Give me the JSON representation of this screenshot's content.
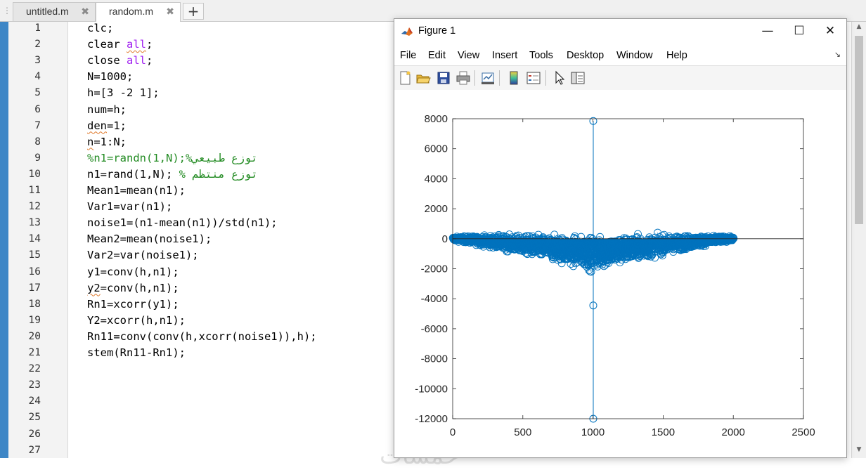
{
  "tabs": [
    {
      "label": "untitled.m",
      "close": "✖",
      "active": false
    },
    {
      "label": "random.m",
      "close": "✖",
      "active": true
    }
  ],
  "add_tab_label": "+",
  "editor": {
    "line_numbers": [
      "1",
      "2",
      "3",
      "4",
      "5",
      "6",
      "7",
      "8",
      "9",
      "10",
      "11",
      "12",
      "13",
      "14",
      "15",
      "16",
      "17",
      "18",
      "19",
      "20",
      "21",
      "22",
      "23",
      "24",
      "25",
      "26",
      "27"
    ],
    "lines": [
      [
        {
          "t": "clc;"
        }
      ],
      [
        {
          "t": "clear "
        },
        {
          "t": "all",
          "c": "kw sq"
        },
        {
          "t": ";"
        }
      ],
      [
        {
          "t": "close "
        },
        {
          "t": "all",
          "c": "kw"
        },
        {
          "t": ";"
        }
      ],
      [
        {
          "t": "N=1000;"
        }
      ],
      [
        {
          "t": "h=[3 -2 1];"
        }
      ],
      [
        {
          "t": "num=h;"
        }
      ],
      [
        {
          "t": "den",
          "c": "sq"
        },
        {
          "t": "=1;"
        }
      ],
      [
        {
          "t": "n",
          "c": "sq"
        },
        {
          "t": "=1:N;"
        }
      ],
      [
        {
          "t": "%n1=randn(1,N);%توزع طبيعي",
          "c": "cmt"
        }
      ],
      [
        {
          "t": "n1=rand(1,N); "
        },
        {
          "t": "% توزع منتظم",
          "c": "cmt"
        }
      ],
      [
        {
          "t": "Mean1=mean(n1);"
        }
      ],
      [
        {
          "t": "Var1=var(n1);"
        }
      ],
      [
        {
          "t": "noise1=(n1-mean(n1))/std(n1);"
        }
      ],
      [
        {
          "t": "Mean2=mean(noise1);"
        }
      ],
      [
        {
          "t": "Var2=var(noise1);"
        }
      ],
      [
        {
          "t": "y1=conv(h,n1);"
        }
      ],
      [
        {
          "t": "y2",
          "c": "sq"
        },
        {
          "t": "=conv(h,n1);"
        }
      ],
      [
        {
          "t": "Rn1=xcorr(y1);"
        }
      ],
      [
        {
          "t": "Y2=xcorr(h,n1);"
        }
      ],
      [
        {
          "t": "Rn11=conv(conv(h,xcorr(noise1)),h);"
        }
      ],
      [
        {
          "t": "stem(Rn11-Rn1);"
        }
      ]
    ],
    "watermark": "خمسات"
  },
  "figure": {
    "title": "Figure 1",
    "window_buttons": {
      "minimize": "—",
      "maximize": "☐",
      "close": "✕"
    },
    "menu": [
      "File",
      "Edit",
      "View",
      "Insert",
      "Tools",
      "Desktop",
      "Window",
      "Help"
    ],
    "menu_dock_icon": "↘",
    "toolbar_icons": [
      "new-figure-icon",
      "open-file-icon",
      "save-icon",
      "print-icon",
      "link-plot-icon",
      "colorbar-icon",
      "legend-icon",
      "pointer-icon",
      "property-inspector-icon"
    ]
  },
  "chart_data": {
    "type": "stem",
    "xlim": [
      0,
      2500
    ],
    "ylim": [
      -12000,
      8000
    ],
    "xticks": [
      0,
      500,
      1000,
      1500,
      2000,
      2500
    ],
    "yticks": [
      8000,
      6000,
      4000,
      2000,
      0,
      -2000,
      -4000,
      -6000,
      -8000,
      -10000,
      -12000
    ],
    "xtick_labels": [
      "0",
      "500",
      "1000",
      "1500",
      "2000",
      "2500"
    ],
    "ytick_labels": [
      "8000",
      "6000",
      "4000",
      "2000",
      "0",
      "-2000",
      "-4000",
      "-6000",
      "-8000",
      "-10000",
      "-12000"
    ],
    "n_points": 2003,
    "marker": "circle-open",
    "color": "#0072bd",
    "notable_points": [
      {
        "x": 1002,
        "y": 7850
      },
      {
        "x": 1002,
        "y": -4450
      },
      {
        "x": 1002,
        "y": -12000
      }
    ],
    "noise_envelope": {
      "center_offset_min": 0,
      "center_offset_mid": -1000,
      "spread_min": 100,
      "spread_mid": 900
    }
  }
}
